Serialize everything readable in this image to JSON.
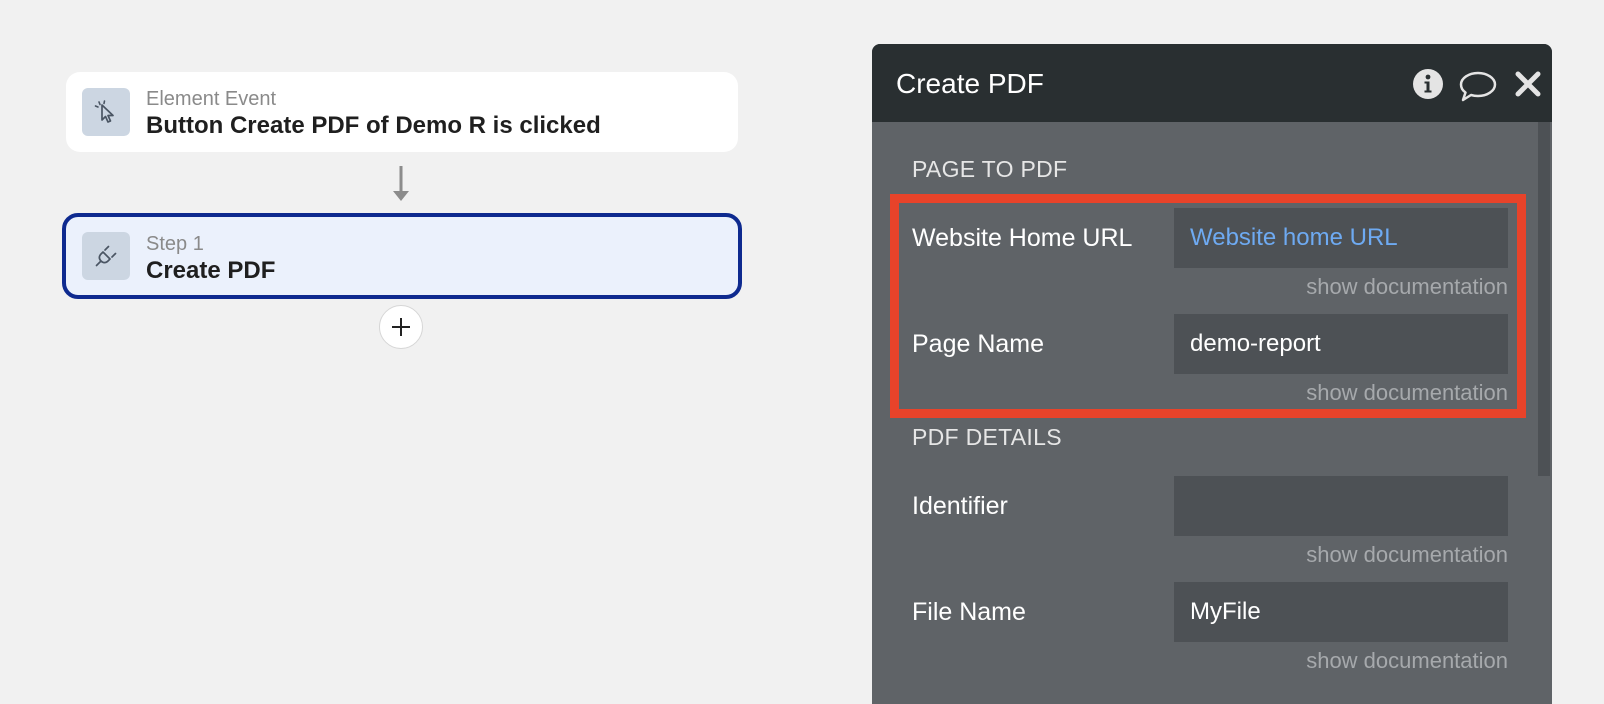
{
  "workflow": {
    "event_card": {
      "subtitle": "Element Event",
      "title": "Button Create PDF of Demo R is clicked",
      "icon": "cursor-click-icon"
    },
    "step_card": {
      "subtitle": "Step 1",
      "title": "Create PDF",
      "icon": "plug-icon"
    },
    "add_step_icon": "plus-icon"
  },
  "panel": {
    "title": "Create PDF",
    "header_icons": [
      "info-icon",
      "comment-icon",
      "close-icon"
    ],
    "sections": {
      "page_to_pdf": "PAGE TO PDF",
      "pdf_details": "PDF DETAILS"
    },
    "fields": {
      "website_home_url": {
        "label": "Website Home URL",
        "value": "Website home URL",
        "doc": "show documentation"
      },
      "page_name": {
        "label": "Page Name",
        "value": "demo-report",
        "doc": "show documentation"
      },
      "identifier": {
        "label": "Identifier",
        "value": "",
        "doc": "show documentation"
      },
      "file_name": {
        "label": "File Name",
        "value": "MyFile",
        "doc": "show documentation"
      }
    },
    "colors": {
      "header_bg": "#292f31",
      "panel_bg": "#5f6367",
      "input_bg": "#4d5155",
      "dynamic_value": "#6eaaf2",
      "highlight": "#e8432a",
      "selected_step_border": "#0e2a8f"
    }
  }
}
